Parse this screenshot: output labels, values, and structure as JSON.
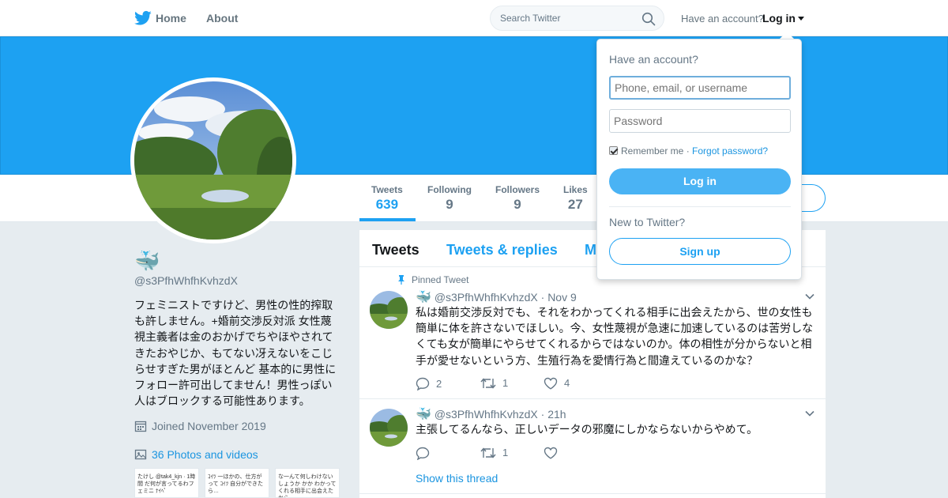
{
  "nav": {
    "logo_icon": "twitter-bird-icon",
    "home_label": "Home",
    "about_label": "About",
    "search_placeholder": "Search Twitter",
    "have_account_label": "Have an account?",
    "login_label": "Log in"
  },
  "colors": {
    "brand": "#1da1f2",
    "link": "#1b95e0",
    "muted": "#657786"
  },
  "profile": {
    "emoji_name": "🐳",
    "handle": "@s3PfhWhfhKvhzdX",
    "bio": "フェミニストですけど、男性の性的搾取も許しません。+婚前交渉反対派 女性蔑視主義者は金のおかげでちやほやされてきたおやじか、もてない冴えないをこじらせすぎた男がほとんど 基本的に男性にフォロー許可出してません！男性っぽい人はブロックする可能性あります。",
    "joined": "Joined November 2019",
    "photos_link": "36 Photos and videos"
  },
  "stats": [
    {
      "label": "Tweets",
      "value": "639"
    },
    {
      "label": "Following",
      "value": "9"
    },
    {
      "label": "Followers",
      "value": "9"
    },
    {
      "label": "Likes",
      "value": "27"
    }
  ],
  "thumbs": [
    "たけし @tak4_kjn · 1時間\nだ何が言ってるわフェミニ\nﾅｲﾍﾟ",
    "ｺｲﾂ 一ほかの、仕方がって\nｺｲﾂ 自分ができたら…\n",
    "な一んて何しわけないしょうか\nかか\nわかってくれる相手に出会えたから"
  ],
  "timeline": {
    "tabs": [
      "Tweets",
      "Tweets & replies",
      "M"
    ],
    "tweets": [
      {
        "pinned_label": "Pinned Tweet",
        "emoji": "🐳",
        "handle": "@s3PfhWhfhKvhzdX",
        "time": "· Nov 9",
        "text": "私は婚前交渉反対でも、それをわかってくれる相手に出会えたから、世の女性も簡単に体を許さないでほしい。今、女性蔑視が急速に加速しているのは苦労しなくても女が簡単にやらせてくれるからではないのか。体の相性が分からないと相手が愛せないという方、生殖行為を愛情行為と間違えているのかな？",
        "replies": "2",
        "retweets": "1",
        "likes": "4"
      },
      {
        "emoji": "🐳",
        "handle": "@s3PfhWhfhKvhzdX",
        "time": "· 21h",
        "text": "主張してるんなら、正しいデータの邪魔にしかならないからやめて。",
        "replies": "",
        "retweets": "1",
        "likes": "",
        "show_thread": "Show this thread"
      }
    ]
  },
  "login_dropdown": {
    "title": "Have an account?",
    "username_placeholder": "Phone, email, or username",
    "password_placeholder": "Password",
    "remember_label": "Remember me",
    "separator": " · ",
    "forgot_label": "Forgot password?",
    "login_button": "Log in",
    "new_label": "New to Twitter?",
    "signup_button": "Sign up"
  }
}
